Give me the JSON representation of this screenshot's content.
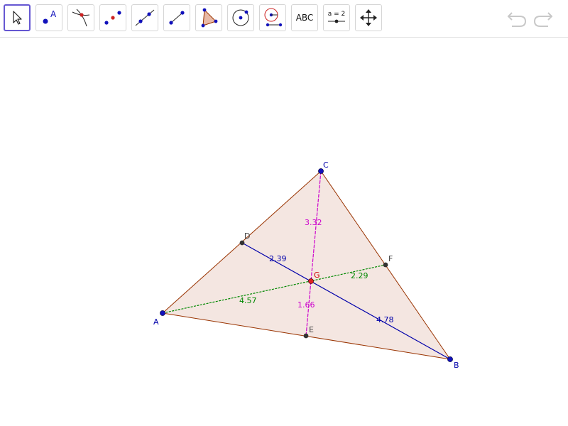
{
  "toolbar": {
    "tools": [
      {
        "name": "move-tool",
        "active": true
      },
      {
        "name": "point-tool",
        "icon_text": "A"
      },
      {
        "name": "intersect-tool"
      },
      {
        "name": "midpoint-tool"
      },
      {
        "name": "line-tool"
      },
      {
        "name": "segment-tool"
      },
      {
        "name": "polygon-tool"
      },
      {
        "name": "circle-tool"
      },
      {
        "name": "angle-tool"
      },
      {
        "name": "text-tool",
        "label": "ABC"
      },
      {
        "name": "slider-tool",
        "label": "a = 2"
      },
      {
        "name": "move-graphics-tool"
      }
    ],
    "undo_icon": "undo-icon",
    "redo_icon": "redo-icon"
  },
  "colors": {
    "triangle_fill": "#f4e6e1",
    "triangle_edge": "#993300",
    "median_ad": "#0000aa",
    "median_be": "#008800",
    "median_cf": "#cc00cc",
    "point_blue": "#1111bb",
    "point_dark": "#333333",
    "point_red": "#dd2222",
    "label_blue": "#0000aa",
    "label_dark": "#444444",
    "label_red": "#cc0000",
    "accent": "#6557d2"
  },
  "construction": {
    "points": {
      "A": {
        "label": "A"
      },
      "B": {
        "label": "B"
      },
      "C": {
        "label": "C"
      },
      "D": {
        "label": "D"
      },
      "E": {
        "label": "E"
      },
      "F": {
        "label": "F"
      },
      "G": {
        "label": "G"
      }
    },
    "segments": {
      "DG": "2.39",
      "GB": "4.78",
      "AG": "4.57",
      "GF": "2.29",
      "CG": "3.32",
      "GE": "1.66"
    }
  }
}
